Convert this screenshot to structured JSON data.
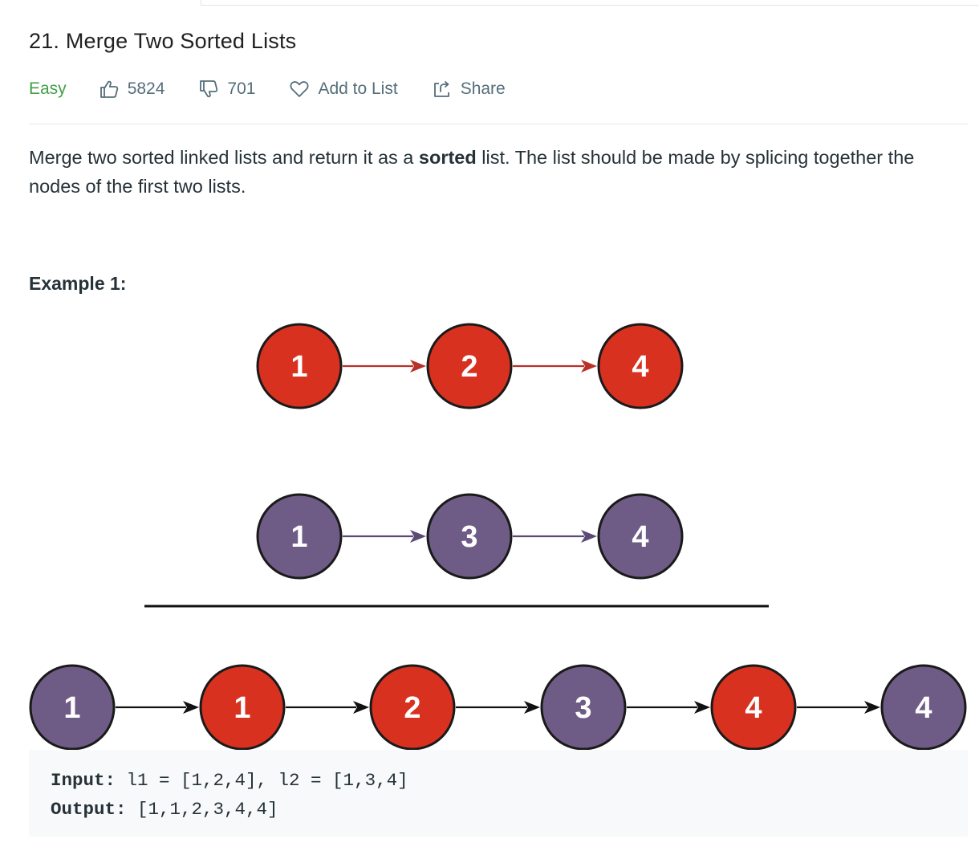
{
  "problem": {
    "title": "21. Merge Two Sorted Lists",
    "difficulty": "Easy",
    "likes": "5824",
    "dislikes": "701",
    "add_to_list": "Add to List",
    "share": "Share"
  },
  "description": {
    "before": "Merge two sorted linked lists and return it as a ",
    "bold": "sorted",
    "after": " list. The list should be made by splicing together the nodes of the first two lists."
  },
  "example": {
    "heading": "Example 1:",
    "list1": [
      "1",
      "2",
      "4"
    ],
    "list2": [
      "1",
      "3",
      "4"
    ],
    "merged": [
      {
        "value": "1",
        "source": "list2"
      },
      {
        "value": "1",
        "source": "list1"
      },
      {
        "value": "2",
        "source": "list1"
      },
      {
        "value": "3",
        "source": "list2"
      },
      {
        "value": "4",
        "source": "list1"
      },
      {
        "value": "4",
        "source": "list2"
      }
    ],
    "input_label": "Input:",
    "input_value": " l1 = [1,2,4], l2 = [1,3,4]",
    "output_label": "Output:",
    "output_value": " [1,1,2,3,4,4]"
  },
  "colors": {
    "list1_node": "#d9311f",
    "list2_node": "#6f5c86",
    "list1_arrow": "#b8322a",
    "list2_arrow": "#5b4a74",
    "merged_arrow": "#111111",
    "difficulty_easy": "#43a047"
  },
  "icons": {
    "like": "thumbs-up-icon",
    "dislike": "thumbs-down-icon",
    "add_to_list": "heart-icon",
    "share": "share-icon"
  }
}
